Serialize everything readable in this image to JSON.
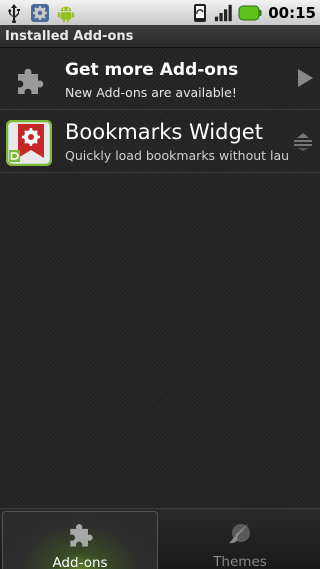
{
  "statusbar": {
    "time": "00:15",
    "icons": [
      "usb-icon",
      "settings-notification-icon",
      "android-icon",
      "rotation-icon",
      "signal-icon",
      "battery-icon"
    ]
  },
  "titlebar": {
    "title": "Installed Add-ons"
  },
  "list": {
    "items": [
      {
        "title": "Get more Add-ons",
        "subtitle": "New Add-ons are available!",
        "icon": "puzzle-icon",
        "trailing": "arrow-right-icon"
      },
      {
        "title": "Bookmarks Widget",
        "subtitle": "Quickly load bookmarks without lau",
        "icon": "bookmarks-widget-icon",
        "trailing": "drag-handle-icon"
      }
    ]
  },
  "tabs": [
    {
      "label": "Add-ons",
      "icon": "puzzle-icon",
      "selected": true
    },
    {
      "label": "Themes",
      "icon": "brush-icon",
      "selected": false
    }
  ],
  "colors": {
    "accent_green": "#7cb83a",
    "background": "#252525",
    "statusbar": "#d9d9d9",
    "battery": "#5cc31e"
  }
}
